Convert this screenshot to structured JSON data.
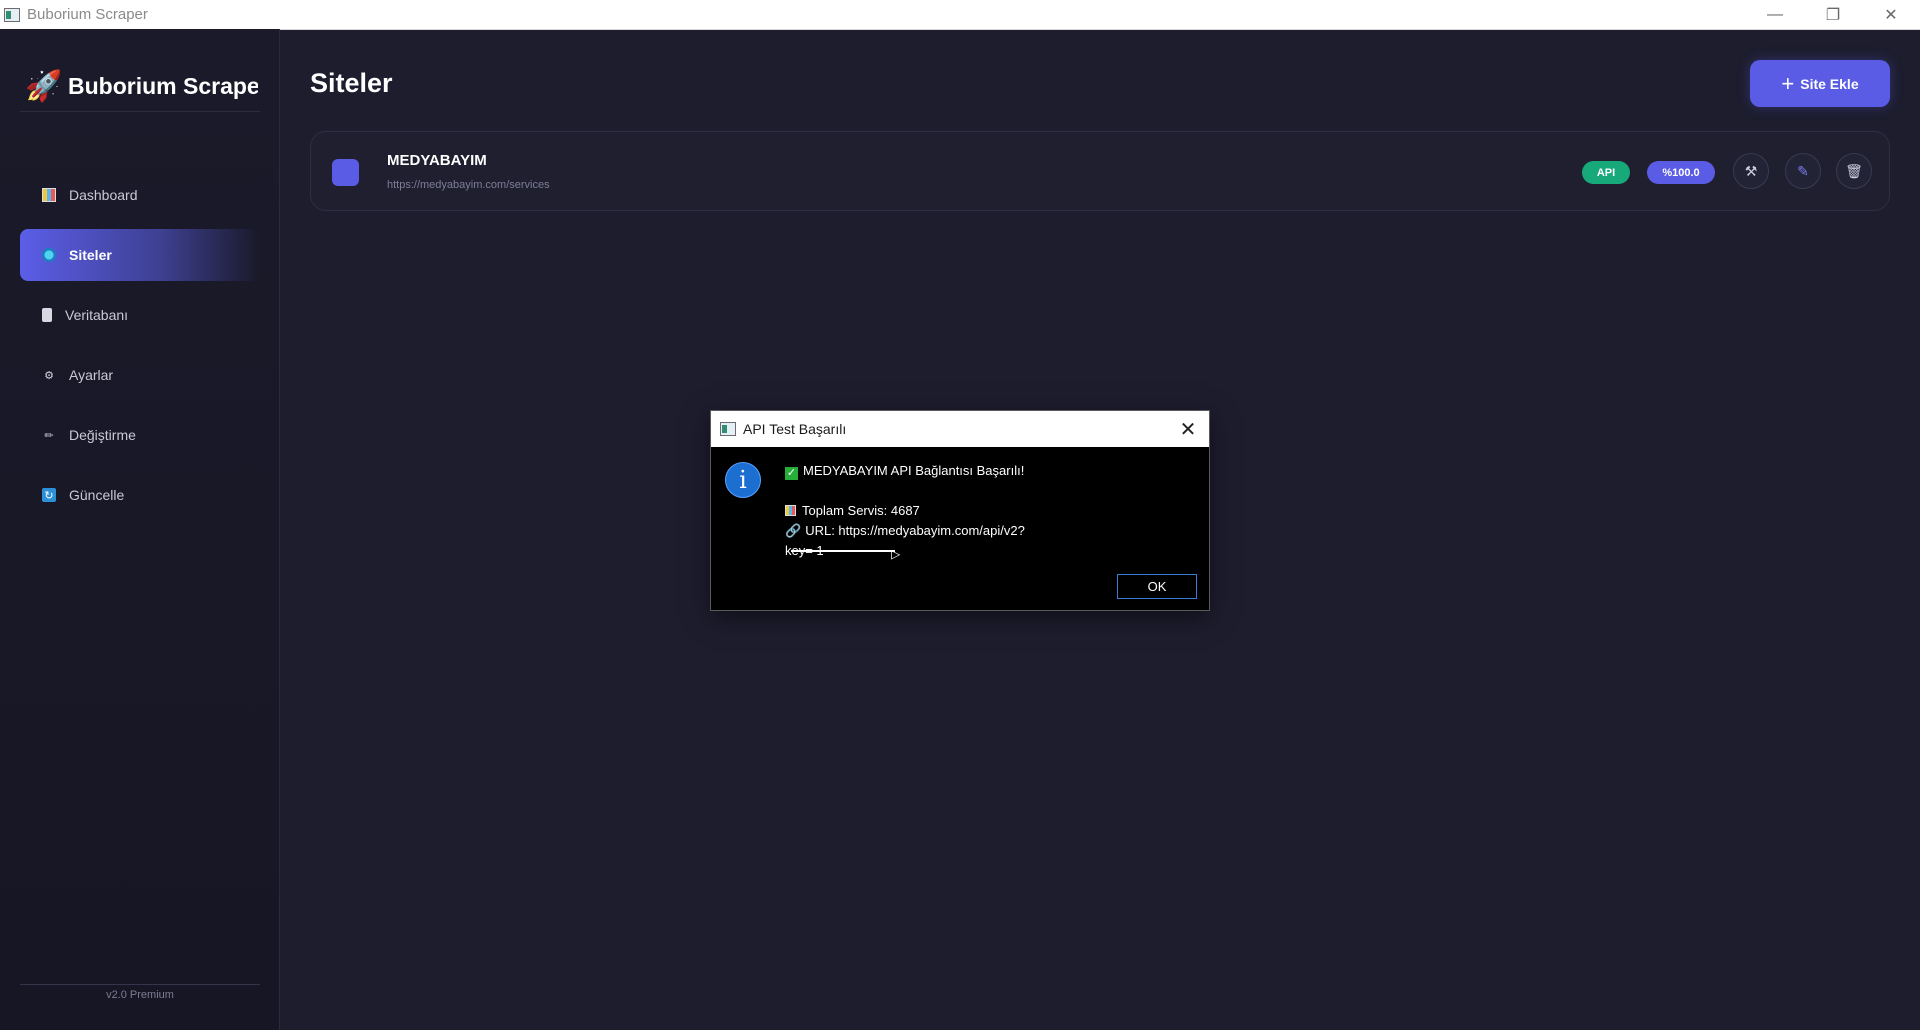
{
  "window": {
    "title": "Buborium Scraper"
  },
  "sidebar": {
    "brand": "Buborium Scraper",
    "items": [
      {
        "label": "Dashboard"
      },
      {
        "label": "Siteler"
      },
      {
        "label": "Veritabanı"
      },
      {
        "label": "Ayarlar"
      },
      {
        "label": "Değiştirme"
      },
      {
        "label": "Güncelle"
      }
    ],
    "version": "v2.0 Premium"
  },
  "main": {
    "title": "Siteler",
    "add_button": "Site Ekle",
    "sites": [
      {
        "name": "MEDYABAYIM",
        "url": "https://medyabayim.com/services",
        "badge_type": "API",
        "badge_pct": "%100.0",
        "color": "#5a5ce6"
      }
    ]
  },
  "dialog": {
    "title": "API Test Başarılı",
    "line1": "MEDYABAYIM API Bağlantısı Başarılı!",
    "line2": "Toplam Servis: 4687",
    "line3": "URL: https://medyabayim.com/api/v2?",
    "line4": "key= 1",
    "ok": "OK"
  },
  "colors": {
    "accent": "#5a5ce6",
    "api_badge": "#18a97a",
    "background": "#1d1d2e"
  },
  "icons": [
    "rocket-icon",
    "chart-icon",
    "globe-icon",
    "database-icon",
    "gear-icon",
    "pencil-icon",
    "refresh-icon",
    "plus-icon",
    "wrench-icon",
    "edit-icon",
    "trash-icon",
    "info-icon",
    "check-icon",
    "link-icon",
    "close-icon"
  ]
}
